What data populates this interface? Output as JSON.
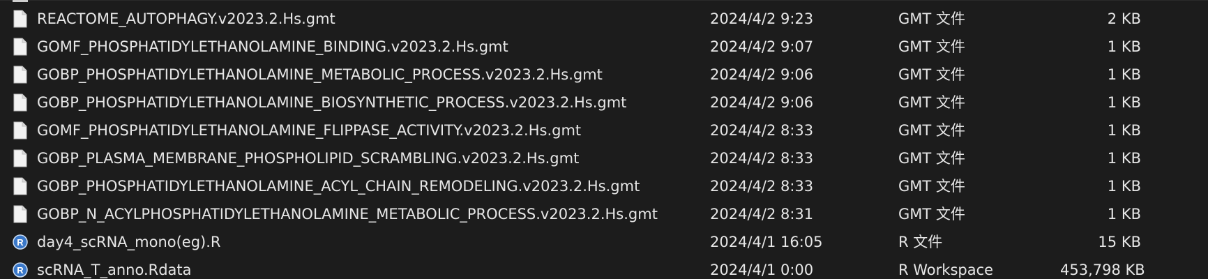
{
  "files": [
    {
      "name": "REACTOME_AUTOPHAGY.v2023.2.Hs.gmt",
      "date": "2024/4/2 9:23",
      "type": "GMT 文件",
      "size": "2 KB",
      "icon": "document-icon"
    },
    {
      "name": "GOMF_PHOSPHATIDYLETHANOLAMINE_BINDING.v2023.2.Hs.gmt",
      "date": "2024/4/2 9:07",
      "type": "GMT 文件",
      "size": "1 KB",
      "icon": "document-icon"
    },
    {
      "name": "GOBP_PHOSPHATIDYLETHANOLAMINE_METABOLIC_PROCESS.v2023.2.Hs.gmt",
      "date": "2024/4/2 9:06",
      "type": "GMT 文件",
      "size": "1 KB",
      "icon": "document-icon"
    },
    {
      "name": "GOBP_PHOSPHATIDYLETHANOLAMINE_BIOSYNTHETIC_PROCESS.v2023.2.Hs.gmt",
      "date": "2024/4/2 9:06",
      "type": "GMT 文件",
      "size": "1 KB",
      "icon": "document-icon"
    },
    {
      "name": "GOMF_PHOSPHATIDYLETHANOLAMINE_FLIPPASE_ACTIVITY.v2023.2.Hs.gmt",
      "date": "2024/4/2 8:33",
      "type": "GMT 文件",
      "size": "1 KB",
      "icon": "document-icon"
    },
    {
      "name": "GOBP_PLASMA_MEMBRANE_PHOSPHOLIPID_SCRAMBLING.v2023.2.Hs.gmt",
      "date": "2024/4/2 8:33",
      "type": "GMT 文件",
      "size": "1 KB",
      "icon": "document-icon"
    },
    {
      "name": "GOBP_PHOSPHATIDYLETHANOLAMINE_ACYL_CHAIN_REMODELING.v2023.2.Hs.gmt",
      "date": "2024/4/2 8:33",
      "type": "GMT 文件",
      "size": "1 KB",
      "icon": "document-icon"
    },
    {
      "name": "GOBP_N_ACYLPHOSPHATIDYLETHANOLAMINE_METABOLIC_PROCESS.v2023.2.Hs.gmt",
      "date": "2024/4/2 8:31",
      "type": "GMT 文件",
      "size": "1 KB",
      "icon": "document-icon"
    },
    {
      "name": "day4_scRNA_mono(eg).R",
      "date": "2024/4/1 16:05",
      "type": "R 文件",
      "size": "15 KB",
      "icon": "r-script-icon"
    },
    {
      "name": "scRNA_T_anno.Rdata",
      "date": "2024/4/1 0:00",
      "type": "R Workspace",
      "size": "453,798 KB",
      "icon": "r-workspace-icon"
    }
  ],
  "colors": {
    "background": "#1c1c1c",
    "text": "#e6e6e6",
    "r_icon_blue": "#3a78c9"
  }
}
